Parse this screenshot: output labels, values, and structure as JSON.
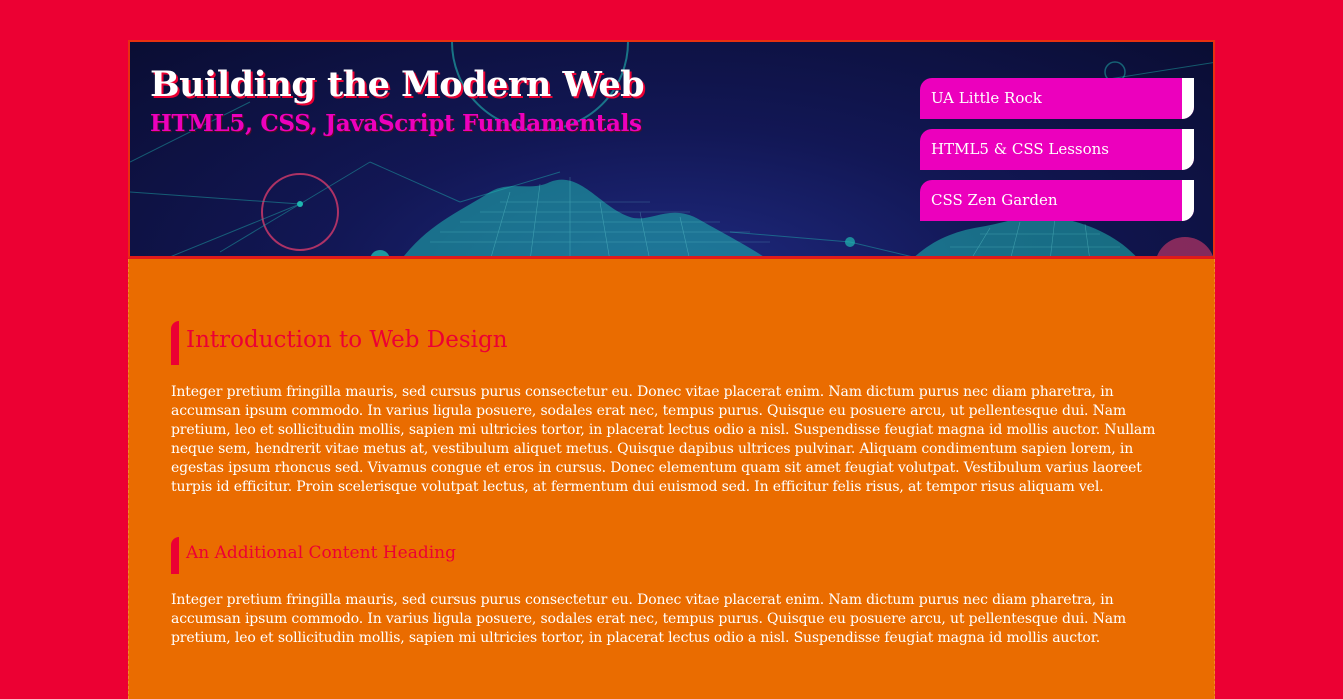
{
  "header": {
    "title": "Building the Modern Web",
    "subtitle": "HTML5, CSS, JavaScript Fundamentals"
  },
  "nav": {
    "items": [
      {
        "label": "UA Little Rock"
      },
      {
        "label": "HTML5 & CSS Lessons"
      },
      {
        "label": "CSS Zen Garden"
      }
    ]
  },
  "main": {
    "heading": "Introduction to Web Design",
    "paragraph1": "Integer pretium fringilla mauris, sed cursus purus consectetur eu. Donec vitae placerat enim. Nam dictum purus nec diam pharetra, in accumsan ipsum commodo. In varius ligula posuere, sodales erat nec, tempus purus. Quisque eu posuere arcu, ut pellentesque dui. Nam pretium, leo et sollicitudin mollis, sapien mi ultricies tortor, in placerat lectus odio a nisl. Suspendisse feugiat magna id mollis auctor. Nullam neque sem, hendrerit vitae metus at, vestibulum aliquet metus. Quisque dapibus ultrices pulvinar. Aliquam condimentum sapien lorem, in egestas ipsum rhoncus sed. Vivamus congue et eros in cursus. Donec elementum quam sit amet feugiat volutpat. Vestibulum varius laoreet turpis id efficitur. Proin scelerisque volutpat lectus, at fermentum dui euismod sed. In efficitur felis risus, at tempor risus aliquam vel.",
    "subheading": "An Additional Content Heading",
    "paragraph2": "Integer pretium fringilla mauris, sed cursus purus consectetur eu. Donec vitae placerat enim. Nam dictum purus nec diam pharetra, in accumsan ipsum commodo. In varius ligula posuere, sodales erat nec, tempus purus. Quisque eu posuere arcu, ut pellentesque dui. Nam pretium, leo et sollicitudin mollis, sapien mi ultricies tortor, in placerat lectus odio a nisl. Suspendisse feugiat magna id mollis auctor."
  },
  "colors": {
    "page_background": "#ec0033",
    "content_background": "#ea6c00",
    "nav_background": "#ec00bd",
    "heading_color": "#ec0033",
    "subtitle_color": "#ec00bd"
  }
}
